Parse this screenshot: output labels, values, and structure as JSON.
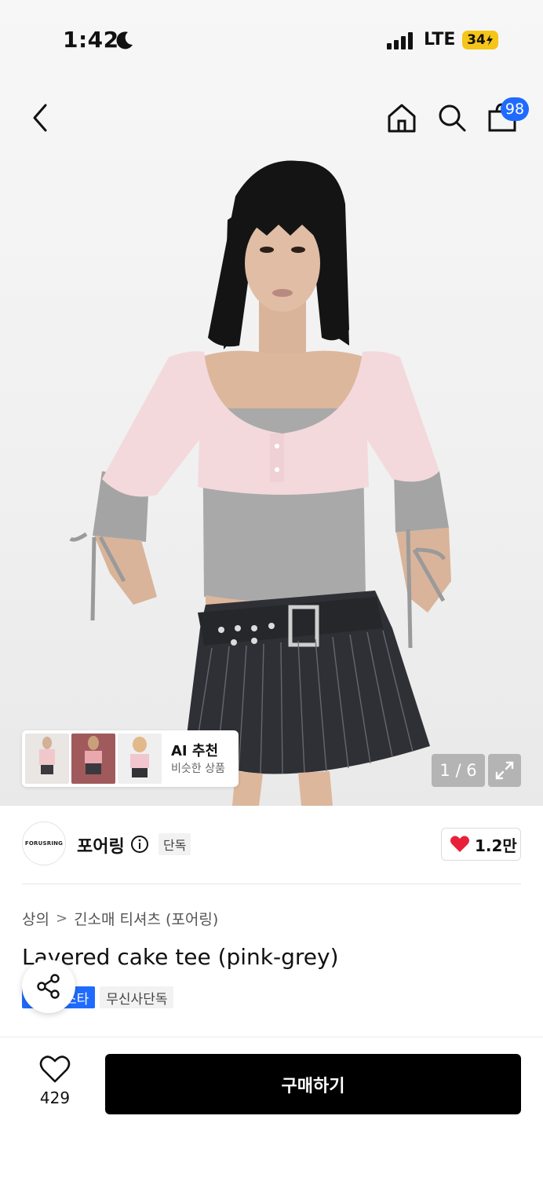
{
  "status_bar": {
    "time": "1:42",
    "network": "LTE",
    "battery": "34"
  },
  "nav": {
    "back_icon": "chevron-left-icon",
    "home_icon": "home-icon",
    "search_icon": "search-icon",
    "bag_icon": "shopping-bag-icon",
    "bag_badge": "98"
  },
  "gallery": {
    "page_indicator": "1 / 6",
    "expand_icon": "expand-icon"
  },
  "ai_recommend": {
    "title": "AI 추천",
    "subtitle": "비슷한 상품",
    "chevron": "›"
  },
  "brand": {
    "logo_text": "FORUSRING",
    "name": "포어링",
    "exclusive_label": "단독",
    "like_count": "1.2만"
  },
  "breadcrumb": {
    "category": "상의",
    "separator": ">",
    "subcategory": "긴소매 티셔츠 (포어링)"
  },
  "product": {
    "title": "Layered cake tee (pink-grey)",
    "tag_blue": "스타",
    "tag_gray": "무신사단독"
  },
  "bottom_bar": {
    "wish_count": "429",
    "buy_label": "구매하기"
  },
  "colors": {
    "accent_blue": "#1f6bff",
    "heart_red": "#e8213a",
    "buy_button": "#000000"
  }
}
